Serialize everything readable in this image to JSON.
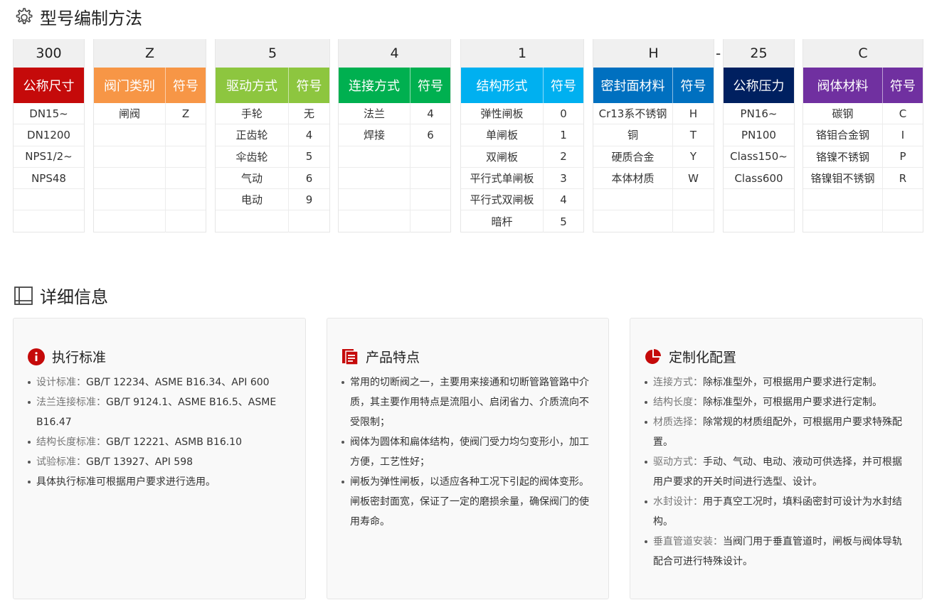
{
  "section1_title": "型号编制方法",
  "section2_title": "详细信息",
  "dash": "-",
  "groups": [
    {
      "top": "300",
      "h1": "公称尺寸",
      "h2": "",
      "color": "#c50a0a",
      "rows": [
        [
          "DN15~",
          ""
        ],
        [
          "DN1200",
          ""
        ],
        [
          "NPS1/2~",
          ""
        ],
        [
          "NPS48",
          ""
        ],
        [
          "",
          ""
        ],
        [
          "",
          ""
        ]
      ]
    },
    {
      "top": "Z",
      "h1": "阀门类别",
      "h2": "符号",
      "color": "#f79646",
      "rows": [
        [
          "闸阀",
          "Z"
        ],
        [
          "",
          ""
        ],
        [
          "",
          ""
        ],
        [
          "",
          ""
        ],
        [
          "",
          ""
        ],
        [
          "",
          ""
        ]
      ]
    },
    {
      "top": "5",
      "h1": "驱动方式",
      "h2": "符号",
      "color": "#8dc63f",
      "rows": [
        [
          "手轮",
          "无"
        ],
        [
          "正齿轮",
          "4"
        ],
        [
          "伞齿轮",
          "5"
        ],
        [
          "气动",
          "6"
        ],
        [
          "电动",
          "9"
        ],
        [
          "",
          ""
        ]
      ]
    },
    {
      "top": "4",
      "h1": "连接方式",
      "h2": "符号",
      "color": "#00b050",
      "rows": [
        [
          "法兰",
          "4"
        ],
        [
          "焊接",
          "6"
        ],
        [
          "",
          ""
        ],
        [
          "",
          ""
        ],
        [
          "",
          ""
        ],
        [
          "",
          ""
        ]
      ]
    },
    {
      "top": "1",
      "h1": "结构形式",
      "h2": "符号",
      "color": "#00b0f0",
      "rows": [
        [
          "弹性闸板",
          "0"
        ],
        [
          "单闸板",
          "1"
        ],
        [
          "双闸板",
          "2"
        ],
        [
          "平行式单闸板",
          "3"
        ],
        [
          "平行式双闸板",
          "4"
        ],
        [
          "暗杆",
          "5"
        ]
      ]
    },
    {
      "top": "H",
      "h1": "密封面材料",
      "h2": "符号",
      "color": "#0070c0",
      "rows": [
        [
          "Cr13系不锈钢",
          "H"
        ],
        [
          "铜",
          "T"
        ],
        [
          "硬质合金",
          "Y"
        ],
        [
          "本体材质",
          "W"
        ],
        [
          "",
          ""
        ],
        [
          "",
          ""
        ]
      ]
    },
    {
      "top": "25",
      "h1": "公称压力",
      "h2": "",
      "color": "#002060",
      "rows": [
        [
          "PN16~",
          ""
        ],
        [
          "PN100",
          ""
        ],
        [
          "Class150~",
          ""
        ],
        [
          "Class600",
          ""
        ],
        [
          "",
          ""
        ],
        [
          "",
          ""
        ]
      ]
    },
    {
      "top": "C",
      "h1": "阀体材料",
      "h2": "符号",
      "color": "#7030a0",
      "rows": [
        [
          "碳钢",
          "C"
        ],
        [
          "铬钼合金钢",
          "I"
        ],
        [
          "铬镍不锈钢",
          "P"
        ],
        [
          "铬镍钼不锈钢",
          "R"
        ],
        [
          "",
          ""
        ],
        [
          "",
          ""
        ]
      ]
    }
  ],
  "cards": [
    {
      "title": "执行标准",
      "icon": "info-icon",
      "items": [
        {
          "k": "设计标准：",
          "v": "GB/T 12234、ASME B16.34、API 600"
        },
        {
          "k": "法兰连接标准：",
          "v": "GB/T 9124.1、ASME B16.5、ASME B16.47"
        },
        {
          "k": "结构长度标准：",
          "v": "GB/T 12221、ASMB B16.10"
        },
        {
          "k": "试验标准：",
          "v": "GB/T 13927、API 598"
        },
        {
          "k": "",
          "v": "具体执行标准可根据用户要求进行选用。"
        }
      ]
    },
    {
      "title": "产品特点",
      "icon": "document-icon",
      "items": [
        {
          "k": "",
          "v": "常用的切断阀之一，主要用来接通和切断管路管路中介质，其主要作用特点是流阻小、启闭省力、介质流向不受限制；"
        },
        {
          "k": "",
          "v": "阀体为圆体和扁体结构，使阀门受力均匀变形小，加工方便，工艺性好；"
        },
        {
          "k": "",
          "v": "闸板为弹性闸板，以适应各种工况下引起的阀体变形。闸板密封面宽，保证了一定的磨损余量，确保阀门的使用寿命。"
        }
      ]
    },
    {
      "title": "定制化配置",
      "icon": "pie-chart-icon",
      "items": [
        {
          "k": "连接方式：",
          "v": "除标准型外，可根据用户要求进行定制。"
        },
        {
          "k": "结构长度：",
          "v": "除标准型外，可根据用户要求进行定制。"
        },
        {
          "k": "材质选择：",
          "v": "除常规的材质组配外，可根据用户要求特殊配置。"
        },
        {
          "k": "驱动方式：",
          "v": "手动、气动、电动、液动可供选择，并可根据用户要求的开关时间进行选型、设计。"
        },
        {
          "k": "水封设计：",
          "v": "用于真空工况时，填料函密封可设计为水封结构。"
        },
        {
          "k": "垂直管道安装：",
          "v": "当阀门用于垂直管道时，闸板与阀体导轨配合可进行特殊设计。"
        }
      ]
    }
  ]
}
